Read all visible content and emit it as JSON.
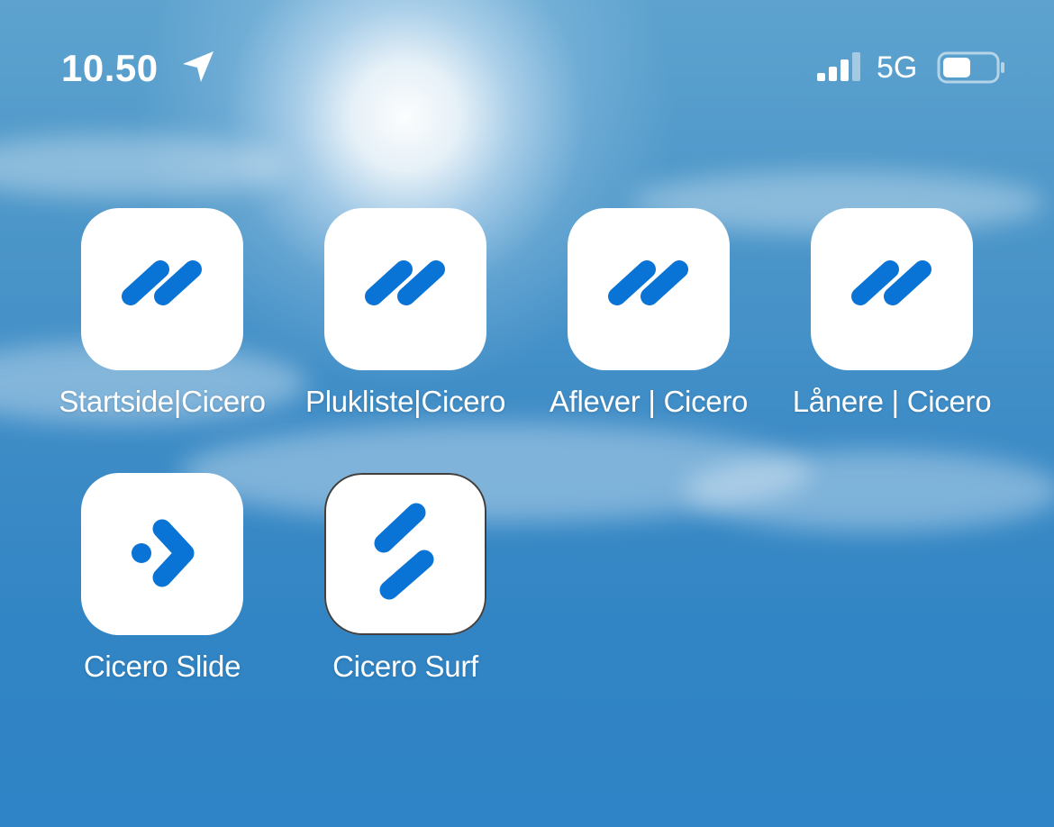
{
  "status_bar": {
    "time": "10.50",
    "network": "5G",
    "icons": [
      "location-arrow-icon",
      "cellular-signal-icon",
      "battery-icon"
    ]
  },
  "apps": [
    {
      "label": "Startside|Cicero",
      "icon": "cicero-double-stroke-icon"
    },
    {
      "label": "Plukliste|Cicero",
      "icon": "cicero-double-stroke-icon"
    },
    {
      "label": "Aflever | Cicero",
      "icon": "cicero-double-stroke-icon"
    },
    {
      "label": "Lånere | Cicero",
      "icon": "cicero-double-stroke-icon"
    },
    {
      "label": "Cicero Slide",
      "icon": "cicero-slide-arrow-icon"
    },
    {
      "label": "Cicero Surf",
      "icon": "cicero-surf-icon"
    }
  ],
  "colors": {
    "icon_blue": "#0a74d6",
    "tile_background": "#ffffff",
    "wallpaper_sky": "#3a8bc7"
  }
}
